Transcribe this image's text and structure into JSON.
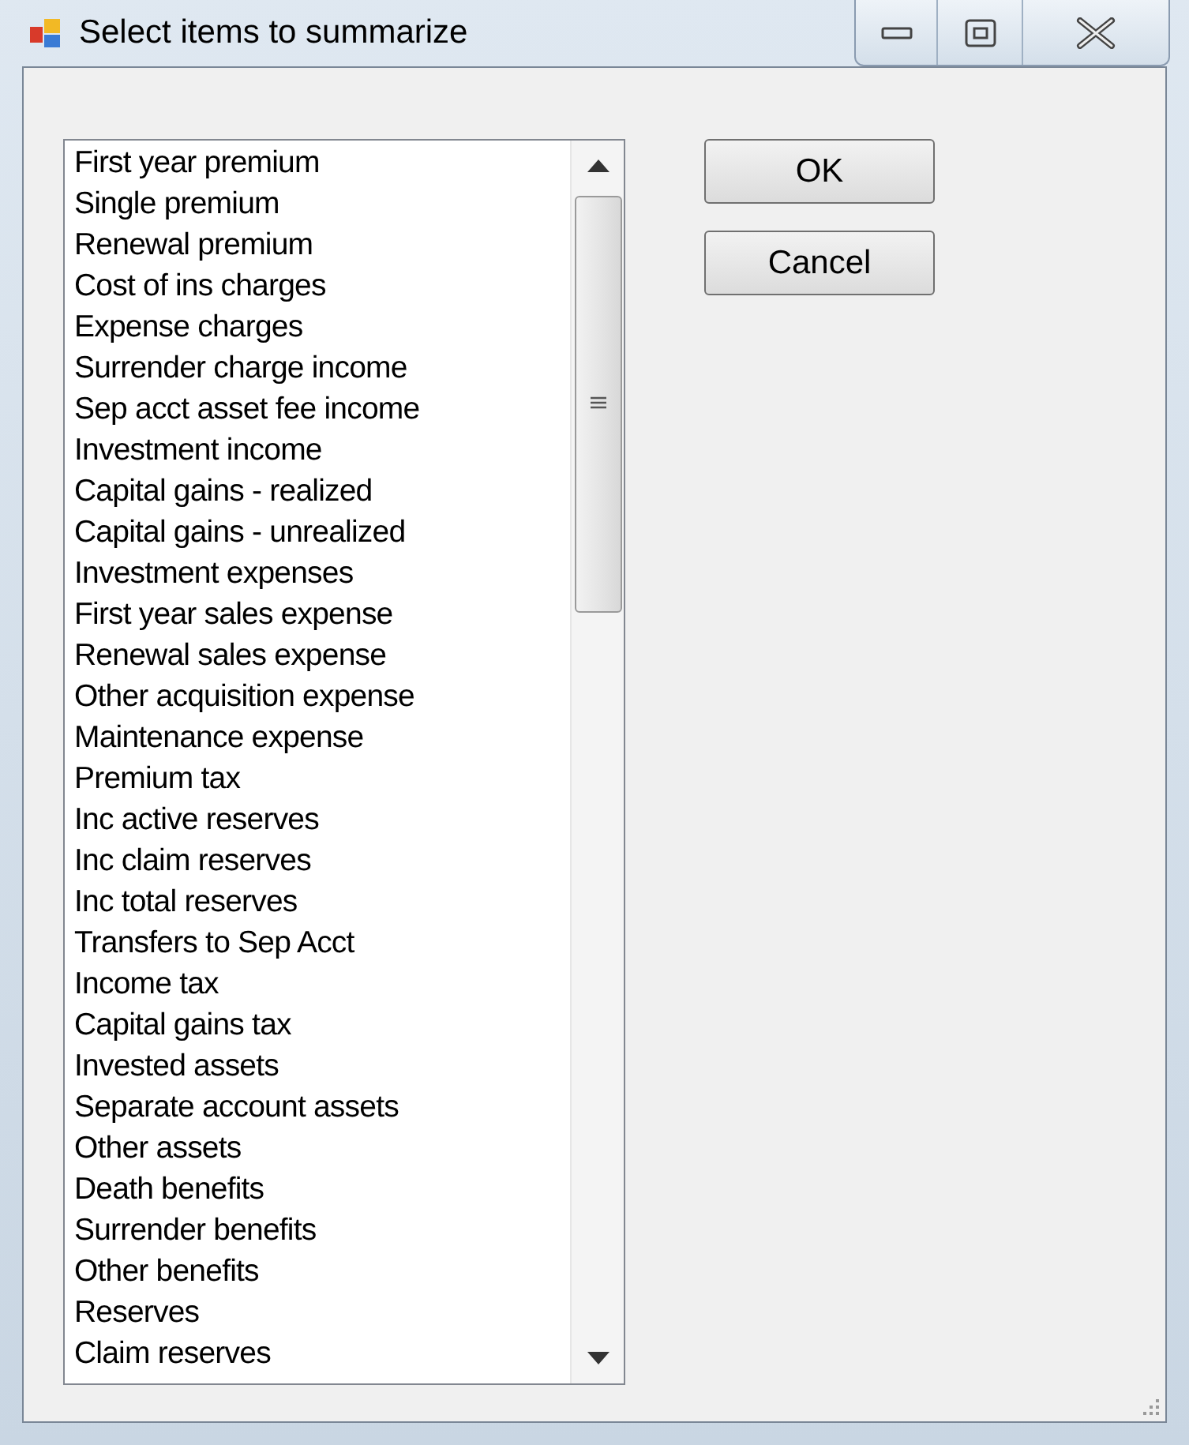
{
  "window": {
    "title": "Select items to summarize"
  },
  "items": [
    "First year premium",
    "Single premium",
    "Renewal premium",
    "Cost of ins charges",
    "Expense charges",
    "Surrender charge income",
    "Sep acct asset fee income",
    "Investment income",
    "Capital gains - realized",
    "Capital gains - unrealized",
    "Investment expenses",
    "First year sales expense",
    "Renewal sales expense",
    "Other acquisition expense",
    "Maintenance expense",
    "Premium tax",
    "Inc active reserves",
    "Inc claim reserves",
    "Inc total reserves",
    "Transfers to Sep Acct",
    "Income tax",
    "Capital gains tax",
    "Invested assets",
    "Separate account assets",
    "Other assets",
    "Death benefits",
    "Surrender benefits",
    "Other benefits",
    "Reserves",
    "Claim reserves"
  ],
  "buttons": [
    "OK",
    "Cancel"
  ]
}
